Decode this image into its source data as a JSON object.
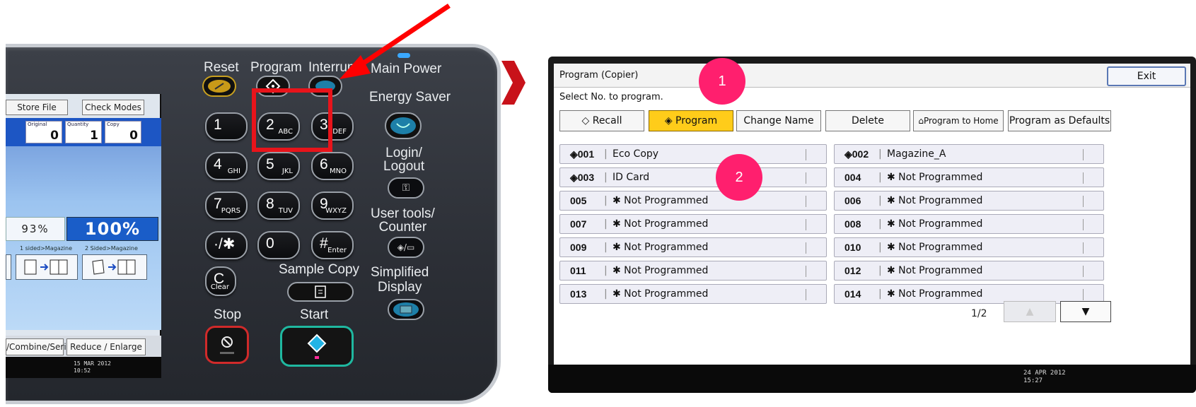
{
  "panel": {
    "lcd": {
      "store_file": "Store File",
      "check_modes": "Check Modes",
      "counters": [
        {
          "label": "Original",
          "value": "0"
        },
        {
          "label": "Quantity",
          "value": "1"
        },
        {
          "label": "Copy",
          "value": "0"
        }
      ],
      "ratio_small": "93%",
      "ratio_big": "100%",
      "magazine_labels": [
        "1 sided>Magazine",
        "2 Sided>Magazine"
      ],
      "combine_series": "/Combine/Series",
      "reduce_enlarge": "Reduce / Enlarge",
      "date_line1": "15 MAR  2012",
      "date_line2": "10:52"
    },
    "labels": {
      "reset": "Reset",
      "program": "Program",
      "interrupt": "Interrupt",
      "main_power": "Main Power",
      "energy_saver": "Energy Saver",
      "login_logout": "Login/\nLogout",
      "user_tools": "User tools/\nCounter",
      "simplified_display": "Simplified\nDisplay",
      "sample_copy": "Sample Copy",
      "stop": "Stop",
      "start": "Start"
    },
    "keys": [
      {
        "big": "1",
        "small": ""
      },
      {
        "big": "2",
        "small": "ABC"
      },
      {
        "big": "3",
        "small": "DEF"
      },
      {
        "big": "4",
        "small": "GHI"
      },
      {
        "big": "5",
        "small": "JKL"
      },
      {
        "big": "6",
        "small": "MNO"
      },
      {
        "big": "7",
        "small": "PQRS"
      },
      {
        "big": "8",
        "small": "TUV"
      },
      {
        "big": "9",
        "small": "WXYZ"
      },
      {
        "big": "·/✱",
        "small": ""
      },
      {
        "big": "0",
        "small": ""
      },
      {
        "big": "#",
        "small": "Enter"
      },
      {
        "big": "C",
        "small": "Clear"
      }
    ]
  },
  "screen": {
    "title": "Program (Copier)",
    "exit": "Exit",
    "subtitle": "Select No. to program.",
    "toolbar": {
      "recall": "◇ Recall",
      "program": "◈ Program",
      "change_name": "Change Name",
      "delete": "Delete",
      "program_to_home": "Program to Home",
      "program_as_defaults": "Program as Defaults"
    },
    "slots": [
      {
        "num": "◈001",
        "name": "Eco Copy"
      },
      {
        "num": "◈002",
        "name": "Magazine_A"
      },
      {
        "num": "◈003",
        "name": "ID Card"
      },
      {
        "num": "004",
        "name": "✱ Not Programmed"
      },
      {
        "num": "005",
        "name": "✱ Not Programmed"
      },
      {
        "num": "006",
        "name": "✱ Not Programmed"
      },
      {
        "num": "007",
        "name": "✱ Not Programmed"
      },
      {
        "num": "008",
        "name": "✱ Not Programmed"
      },
      {
        "num": "009",
        "name": "✱ Not Programmed"
      },
      {
        "num": "010",
        "name": "✱ Not Programmed"
      },
      {
        "num": "011",
        "name": "✱ Not Programmed"
      },
      {
        "num": "012",
        "name": "✱ Not Programmed"
      },
      {
        "num": "013",
        "name": "✱ Not Programmed"
      },
      {
        "num": "014",
        "name": "✱ Not Programmed"
      }
    ],
    "pager": "1/2",
    "up": "▲",
    "down": "▼",
    "date_line1": "24 APR  2012",
    "date_line2": "15:27"
  },
  "callouts": {
    "badge1": "1",
    "badge2": "2"
  },
  "colors": {
    "highlight": "#e8141b",
    "arrow": "#ff0000",
    "badge": "#ff1f6e",
    "active_tab": "#ffcc1a"
  }
}
